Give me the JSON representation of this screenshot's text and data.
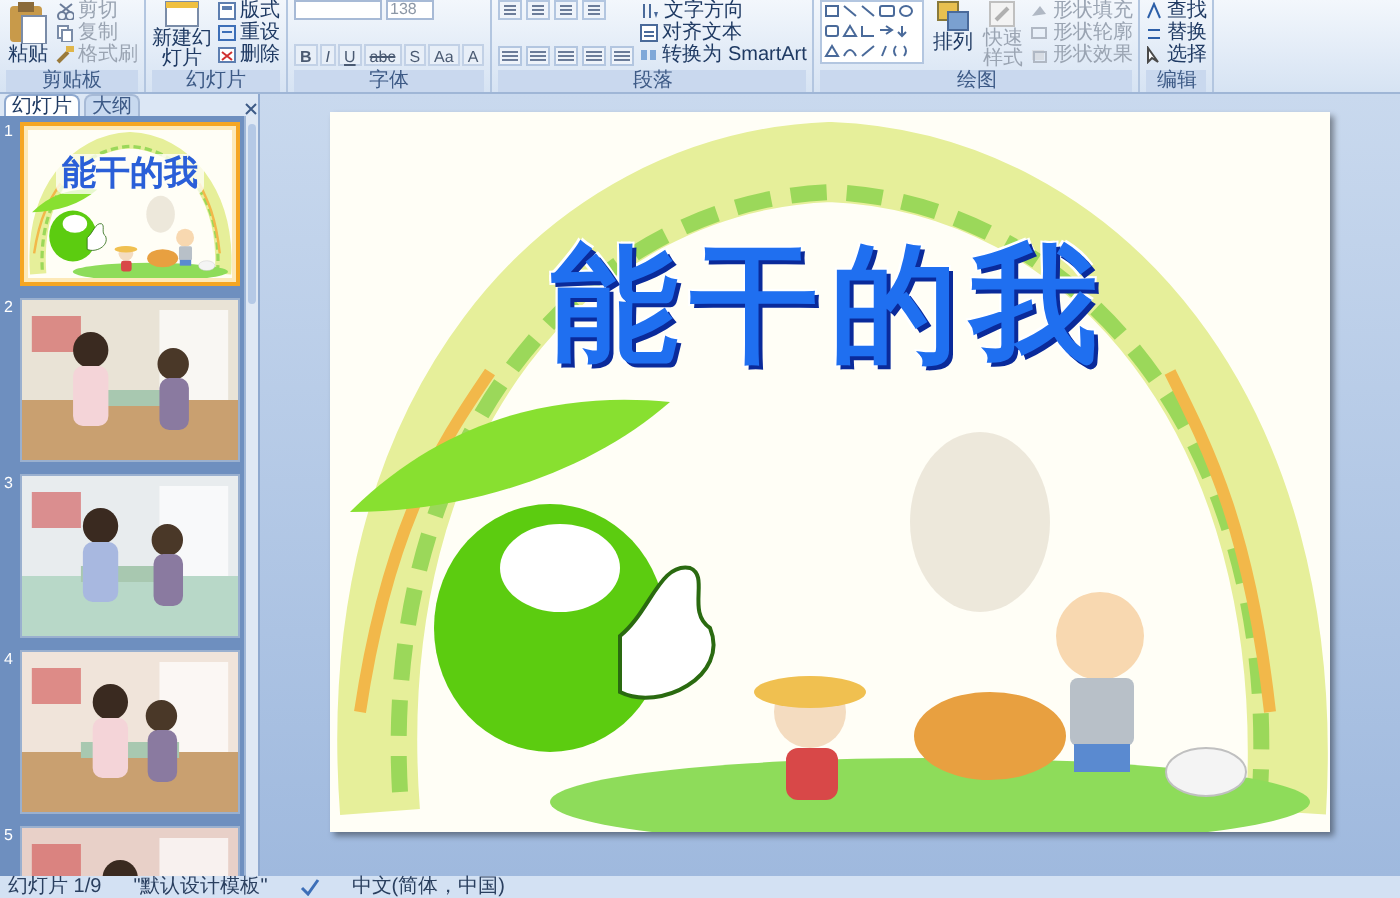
{
  "ribbon": {
    "groups": [
      {
        "kind": "clipboard",
        "label": "剪贴板",
        "buttons": [
          {
            "label": "粘贴",
            "disabled": false
          },
          {
            "label": "剪切",
            "disabled": true
          },
          {
            "label": "复制",
            "disabled": true
          },
          {
            "label": "格式刷",
            "disabled": true
          }
        ]
      },
      {
        "kind": "slides",
        "label": "幻灯片",
        "buttons": [
          {
            "label": "新建幻灯片",
            "disabled": false
          },
          {
            "label": "版式",
            "disabled": false
          },
          {
            "label": "重设",
            "disabled": false
          },
          {
            "label": "删除",
            "disabled": false
          }
        ]
      },
      {
        "kind": "font",
        "label": "字体",
        "font_size": "138",
        "format_buttons": [
          "B",
          "I",
          "U",
          "abc",
          "S",
          "Aa",
          "A"
        ]
      },
      {
        "kind": "paragraph",
        "label": "段落",
        "buttons": [
          {
            "label": "文字方向",
            "disabled": false
          },
          {
            "label": "对齐文本",
            "disabled": false
          },
          {
            "label": "转换为 SmartArt",
            "disabled": false
          }
        ]
      },
      {
        "kind": "drawing",
        "label": "绘图",
        "buttons": [
          {
            "label": "排列",
            "disabled": false
          },
          {
            "label": "快速样式",
            "disabled": true
          },
          {
            "label": "形状填充",
            "disabled": true
          },
          {
            "label": "形状轮廓",
            "disabled": true
          },
          {
            "label": "形状效果",
            "disabled": true
          }
        ]
      },
      {
        "kind": "editing",
        "label": "编辑",
        "buttons": [
          {
            "label": "查找",
            "disabled": false
          },
          {
            "label": "替换",
            "disabled": false
          },
          {
            "label": "选择",
            "disabled": false
          }
        ]
      }
    ]
  },
  "pane": {
    "tabs": [
      {
        "label": "幻灯片",
        "selected": true
      },
      {
        "label": "大纲",
        "selected": false
      }
    ],
    "thumbnails": [
      {
        "number": "1",
        "selected": true,
        "kind": "title",
        "title": "能干的我"
      },
      {
        "number": "2",
        "selected": false
      },
      {
        "number": "3",
        "selected": false
      },
      {
        "number": "4",
        "selected": false
      },
      {
        "number": "5",
        "selected": false
      }
    ]
  },
  "slide": {
    "title": "能干的我"
  },
  "status_bar": {
    "slide": "幻灯片 1/9",
    "theme": "\"默认设计模板\"",
    "language": "中文(简体，中国)"
  }
}
